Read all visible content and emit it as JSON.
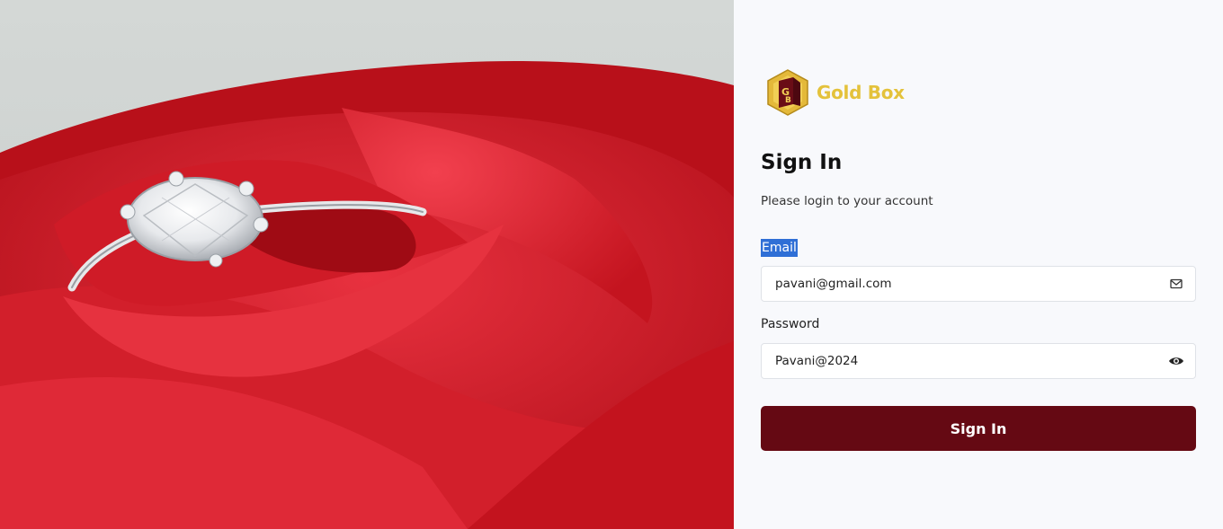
{
  "brand": {
    "name": "Gold Box",
    "color": "#e4c23b",
    "logo_icon": "gold-box-logo-icon"
  },
  "form": {
    "title": "Sign In",
    "subtitle": "Please login to your account",
    "email": {
      "label": "Email",
      "value": "pavani@gmail.com",
      "icon": "mail-icon"
    },
    "password": {
      "label": "Password",
      "value": "Pavani@2024",
      "icon": "eye-icon"
    },
    "submit_label": "Sign In"
  },
  "colors": {
    "primary": "#650913",
    "selection": "#2f6fd6",
    "panel_bg": "#f8f9fc"
  }
}
